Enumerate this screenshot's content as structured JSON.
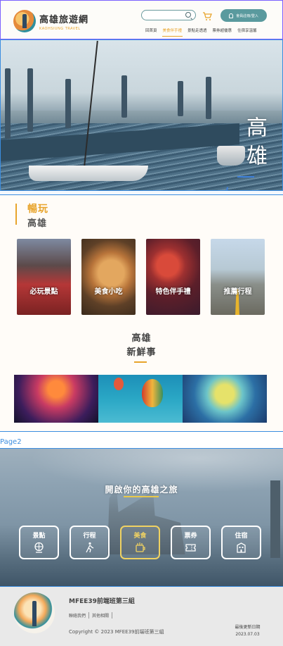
{
  "header": {
    "logo_title": "高雄旅遊網",
    "logo_subtitle": "KAOHSIUNG TRAVEL",
    "member_label": "會員註冊/登入",
    "nav": [
      "回首頁",
      "美食伴手禮",
      "景點走透透",
      "票券超優惠",
      "住宿享溫馨"
    ],
    "active_nav_index": 1,
    "accent_color": "#e8a42c",
    "brand_color": "#5a9a9e"
  },
  "hero": {
    "title": "高雄"
  },
  "play": {
    "label": "暢玩",
    "sub": "高雄",
    "cards": [
      {
        "label": "必玩景點"
      },
      {
        "label": "美食小吃"
      },
      {
        "label": "特色伴手禮"
      },
      {
        "label": "推薦行程"
      }
    ]
  },
  "news": {
    "title_line1": "高雄",
    "title_line2": "新鮮事"
  },
  "page_marker": "Page2",
  "harbor": {
    "title": "開啟你的高雄之旅",
    "categories": [
      {
        "label": "景點",
        "icon": "globe-icon"
      },
      {
        "label": "行程",
        "icon": "hiker-icon"
      },
      {
        "label": "美食",
        "icon": "food-icon"
      },
      {
        "label": "票券",
        "icon": "ticket-icon"
      },
      {
        "label": "住宿",
        "icon": "hotel-icon"
      }
    ],
    "active_category_index": 2
  },
  "footer": {
    "name": "MFEE39前端班第三組",
    "links": [
      "聯絡我們",
      "其他相關"
    ],
    "copyright": "Copyright © 2023 MFEE39前端班第三組",
    "updated_label": "最後更新日期",
    "updated_date": "2023.07.03"
  }
}
